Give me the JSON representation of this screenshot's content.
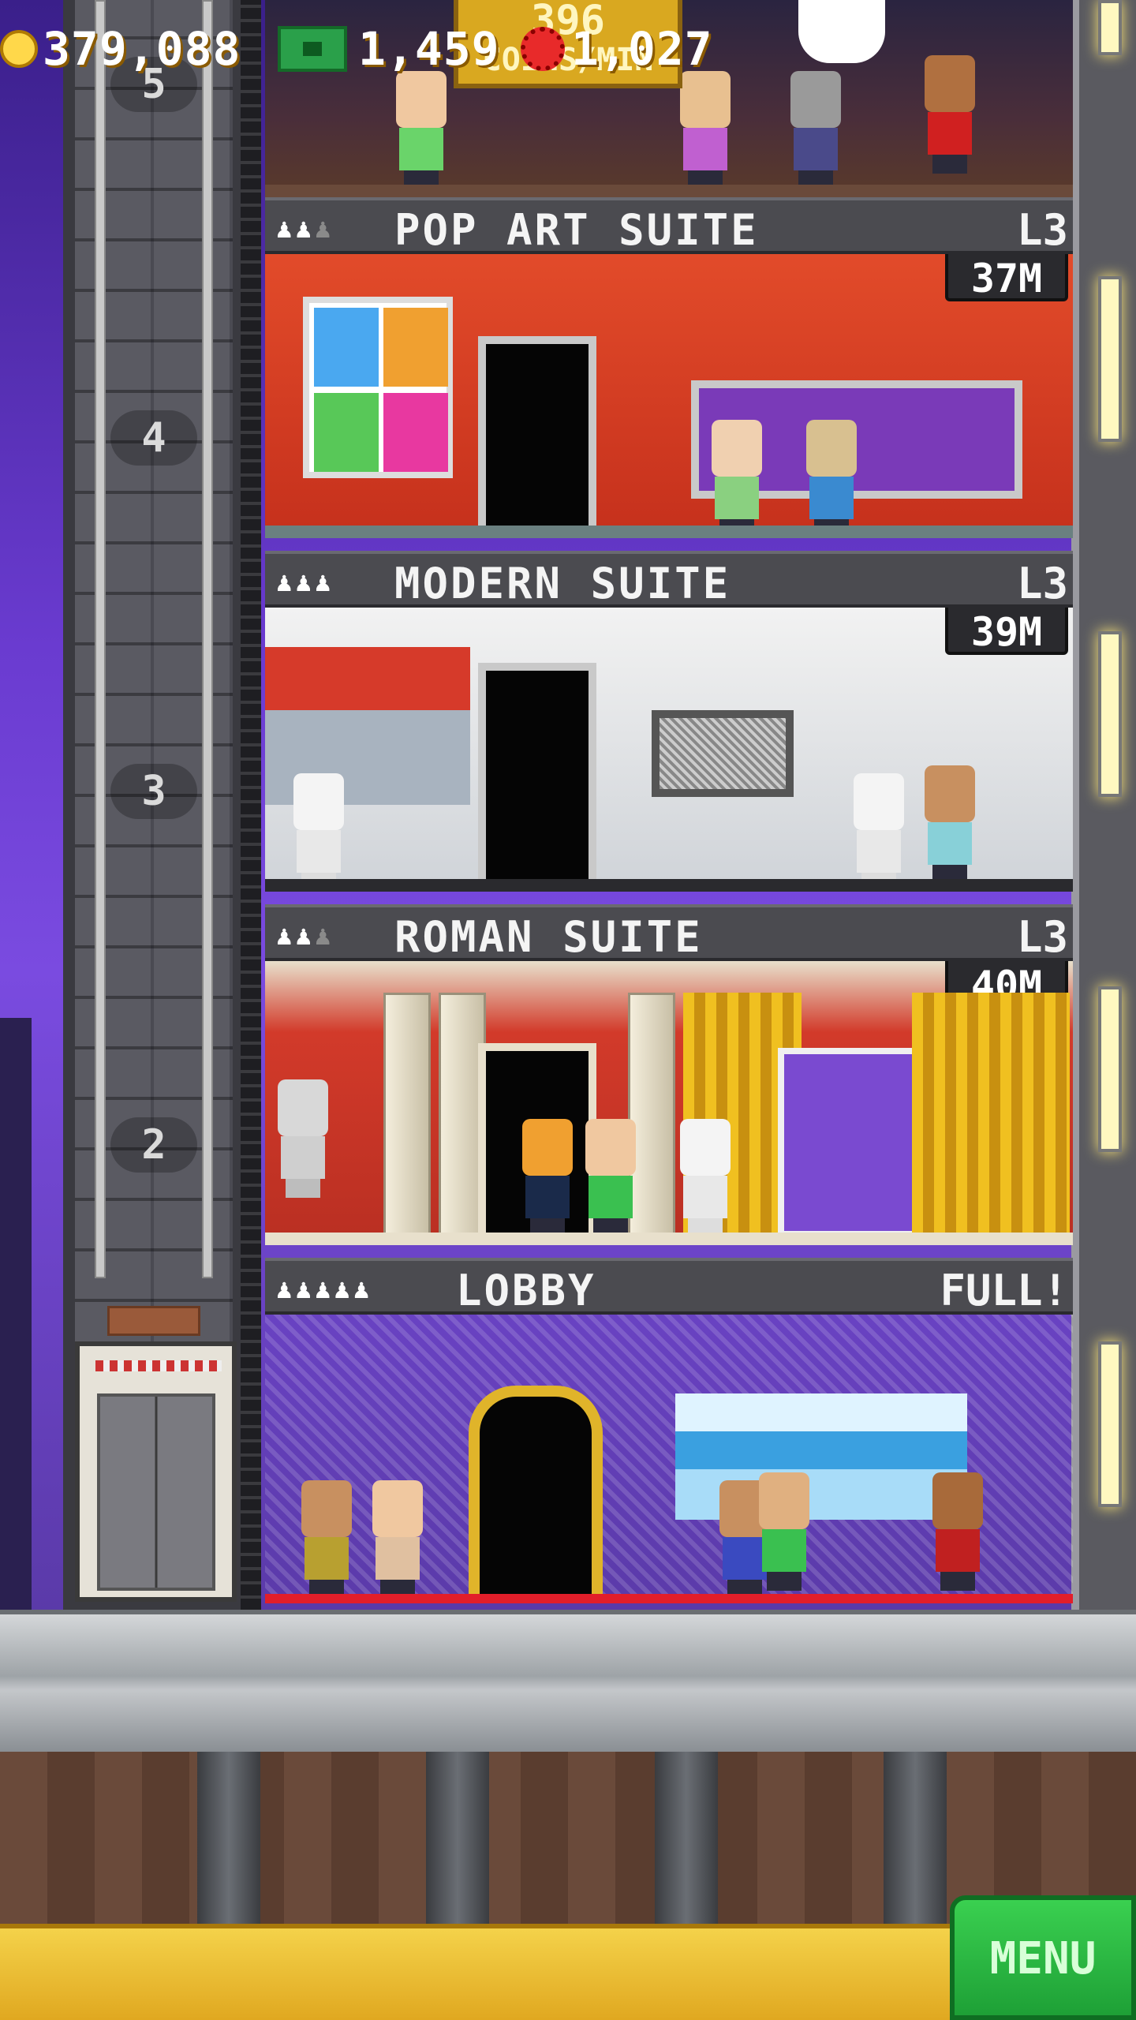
{
  "top_room": {
    "coins_per_min_amount": "396",
    "coins_per_min_unit": "COINS/MIN",
    "floor_number": "5"
  },
  "floors": [
    {
      "name": "POP ART SUITE",
      "level": "L3",
      "stock": "37M",
      "floor_number": "4",
      "residents_filled": 2,
      "residents_capacity": 3
    },
    {
      "name": "MODERN SUITE",
      "level": "L3",
      "stock": "39M",
      "floor_number": "3",
      "residents_filled": 3,
      "residents_capacity": 3
    },
    {
      "name": "ROMAN SUITE",
      "level": "L3",
      "stock": "40M",
      "floor_number": "2",
      "residents_filled": 2,
      "residents_capacity": 3
    },
    {
      "name": "LOBBY",
      "level": "FULL!",
      "residents_filled": 5,
      "residents_capacity": 5
    }
  ],
  "hud": {
    "coins": "379,088",
    "bux": "1,459",
    "points": "1,027",
    "menu_label": "MENU"
  },
  "colors": {
    "hud_gold": "#e0a820",
    "menu_green": "#1ea036",
    "label_bar": "#4b4b50",
    "lobby_carpet": "#e21e2a"
  },
  "icons": [
    "coin-icon",
    "bux-icon",
    "points-icon",
    "person-icon"
  ]
}
